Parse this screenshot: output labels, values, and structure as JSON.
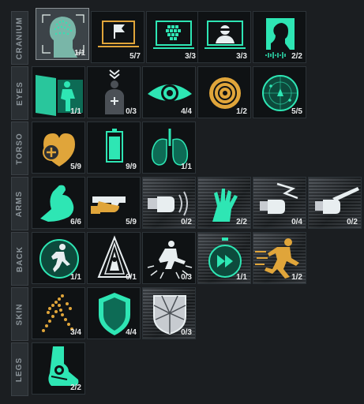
{
  "colors": {
    "accent": "#2ee6b4",
    "accent_dark": "#0d6b55",
    "gold": "#e0a53a",
    "bg": "#1b1e21",
    "cell_bg": "#0f1214"
  },
  "categories": [
    {
      "label": "CRANIUM",
      "perks": [
        {
          "icon": "head-scan-icon",
          "count": "1/1"
        },
        {
          "icon": "flag-screen-icon",
          "count": "5/7"
        },
        {
          "icon": "cube-screen-icon",
          "count": "3/3"
        },
        {
          "icon": "hacker-screen-icon",
          "count": "3/3"
        },
        {
          "icon": "profile-audio-icon",
          "count": "2/2"
        }
      ]
    },
    {
      "label": "EYES",
      "perks": [
        {
          "icon": "see-through-wall-icon",
          "count": "1/1"
        },
        {
          "icon": "target-person-icon",
          "count": "0/3"
        },
        {
          "icon": "eye-icon",
          "count": "4/4"
        },
        {
          "icon": "crosshair-icon",
          "count": "1/2"
        },
        {
          "icon": "radar-icon",
          "count": "5/5"
        }
      ]
    },
    {
      "label": "TORSO",
      "perks": [
        {
          "icon": "heart-health-icon",
          "count": "5/9"
        },
        {
          "icon": "battery-icon",
          "count": "9/9"
        },
        {
          "icon": "lungs-icon",
          "count": "1/1"
        }
      ]
    },
    {
      "label": "ARMS",
      "perks": [
        {
          "icon": "muscle-arm-icon",
          "count": "6/6"
        },
        {
          "icon": "pistol-hand-icon",
          "count": "5/9"
        },
        {
          "icon": "punch-shockwave-icon",
          "count": "0/2"
        },
        {
          "icon": "claw-hand-icon",
          "count": "2/2"
        },
        {
          "icon": "punch-lightning-icon",
          "count": "0/4"
        },
        {
          "icon": "punch-blade-icon",
          "count": "0/2"
        }
      ]
    },
    {
      "label": "BACK",
      "perks": [
        {
          "icon": "runner-circle-icon",
          "count": "1/1"
        },
        {
          "icon": "jump-arrow-icon",
          "count": "0/1"
        },
        {
          "icon": "landing-impact-icon",
          "count": "0/3"
        },
        {
          "icon": "fast-forward-timer-icon",
          "count": "1/1"
        },
        {
          "icon": "sprint-icon",
          "count": "1/2"
        }
      ]
    },
    {
      "label": "SKIN",
      "perks": [
        {
          "icon": "dotted-body-icon",
          "count": "3/4"
        },
        {
          "icon": "shield-icon",
          "count": "4/4"
        },
        {
          "icon": "armor-plate-icon",
          "count": "0/3"
        }
      ]
    },
    {
      "label": "LEGS",
      "perks": [
        {
          "icon": "leg-joint-icon",
          "count": "2/2"
        }
      ]
    }
  ]
}
